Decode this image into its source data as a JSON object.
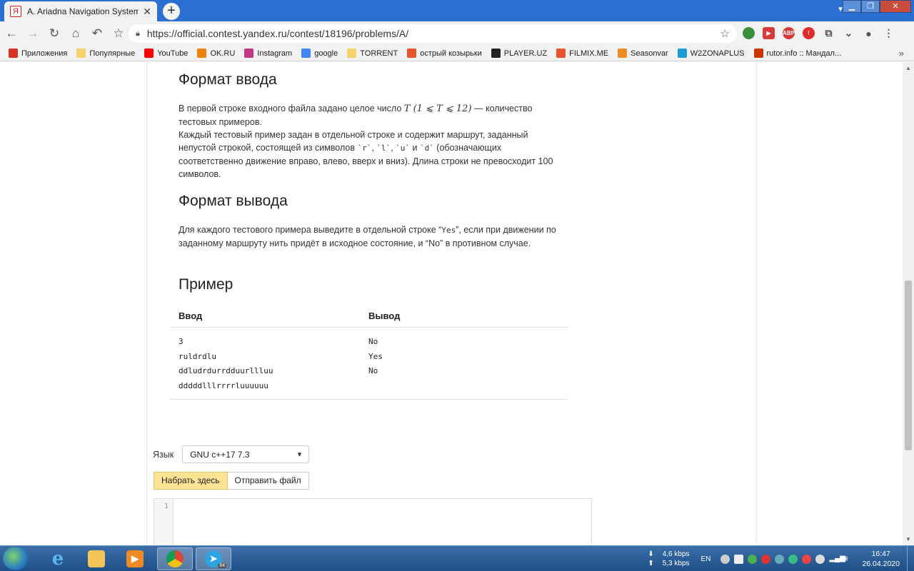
{
  "browser": {
    "tab_title": "A. Ariadna Navigation System —",
    "tab_favicon": "Я",
    "url": "https://official.contest.yandex.ru/contest/18196/problems/A/",
    "new_tab_symbol": "+",
    "bookmarks": [
      {
        "label": "Приложения",
        "icon": "apps-grid-icon",
        "color": "#d93025"
      },
      {
        "label": "Популярные",
        "icon": "folder-icon",
        "color": "#f5d36b"
      },
      {
        "label": "YouTube",
        "icon": "youtube-icon",
        "color": "#ff0000"
      },
      {
        "label": "OK.RU",
        "icon": "ok-icon",
        "color": "#ee8208"
      },
      {
        "label": "Instagram",
        "icon": "instagram-icon",
        "color": "#c13584"
      },
      {
        "label": "google",
        "icon": "google-icon",
        "color": "#4285f4"
      },
      {
        "label": "TORRENT",
        "icon": "folder-icon",
        "color": "#f5d36b"
      },
      {
        "label": "острый козырьки",
        "icon": "filmix-icon",
        "color": "#e8542d"
      },
      {
        "label": "PLAYER.UZ",
        "icon": "player-icon",
        "color": "#222222"
      },
      {
        "label": "FILMIX.ME",
        "icon": "filmix-icon",
        "color": "#e8542d"
      },
      {
        "label": "Seasonvar",
        "icon": "seasonvar-icon",
        "color": "#f08a24"
      },
      {
        "label": "W2ZONAPLUS",
        "icon": "zona-icon",
        "color": "#1e9bd7"
      },
      {
        "label": "rutor.info :: Мандал...",
        "icon": "rutor-icon",
        "color": "#cc3300"
      }
    ]
  },
  "problem": {
    "input_heading": "Формат ввода",
    "input_p1_a": "В первой строке входного файла задано целое число ",
    "input_p1_math": "T (1 ⩽ T ⩽ 12)",
    "input_p1_b": " — количество тестовых примеров.",
    "input_p2_a": "Каждый тестовый пример задан в отдельной строке и содержит маршрут, заданный непустой строкой, состоящей из символов ",
    "sym_r": "`r`",
    "sym_l": "`l`",
    "sym_u": "`u`",
    "sym_d": "`d`",
    "sep1": ", ",
    "sep2": ", ",
    "sep3": " и ",
    "input_p2_b": " (обозначающих соответственно движение вправо, влево, вверх и вниз). Длина строки не превосходит 100 символов.",
    "output_heading": "Формат вывода",
    "output_p_a": "Для каждого тестового примера выведите в отдельной строке “",
    "yes": "Yes",
    "output_p_b": "”, если при движении по заданному маршруту нить придёт в исходное состояние, и “",
    "no": "No",
    "output_p_c": "” в противном случае.",
    "example_heading": "Пример",
    "example_in_header": "Ввод",
    "example_out_header": "Вывод",
    "example_input": "3\nruldrdlu\nddludrdurrdduurllluu\ndddddlllrrrrluuuuuu",
    "example_output": "No\nYes\nNo"
  },
  "submit": {
    "language_label": "Язык",
    "language_value": "GNU c++17 7.3",
    "tab_type_here": "Набрать здесь",
    "tab_send_file": "Отправить файл",
    "editor_line_number": "1"
  },
  "taskbar": {
    "net_down": "4,6 kbps",
    "net_up": "5,3 kbps",
    "lang": "EN",
    "time": "16:47",
    "date": "26.04.2020",
    "telegram_badge": "84"
  }
}
